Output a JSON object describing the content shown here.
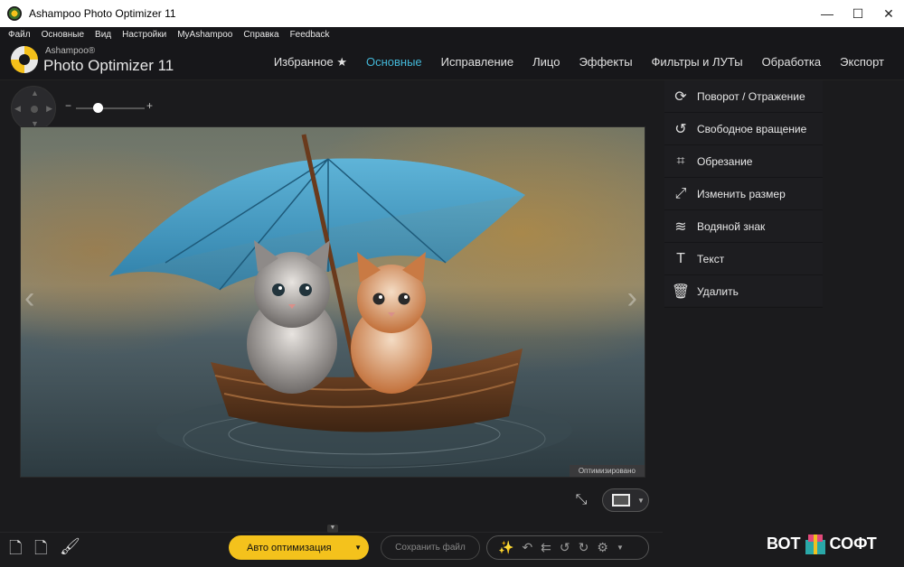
{
  "window": {
    "title": "Ashampoo Photo Optimizer 11",
    "minimize": "—",
    "maximize": "☐",
    "close": "✕"
  },
  "menu": [
    "Файл",
    "Основные",
    "Вид",
    "Настройки",
    "MyAshampoo",
    "Справка",
    "Feedback"
  ],
  "brand": {
    "small": "Ashampoo®",
    "big": "Photo Optimizer 11"
  },
  "tabs": [
    {
      "label": "Избранное ★",
      "active": false
    },
    {
      "label": "Основные",
      "active": true
    },
    {
      "label": "Исправление",
      "active": false
    },
    {
      "label": "Лицо",
      "active": false
    },
    {
      "label": "Эффекты",
      "active": false
    },
    {
      "label": "Фильтры и ЛУТы",
      "active": false
    },
    {
      "label": "Обработка",
      "active": false
    },
    {
      "label": "Экспорт",
      "active": false
    }
  ],
  "zoom": {
    "minus": "−",
    "plus": "+"
  },
  "photo": {
    "badge": "Оптимизировано"
  },
  "sidebar": {
    "items": [
      {
        "label": "Поворот / Отражение",
        "icon": "rotate-flip-icon",
        "glyph": "⟳"
      },
      {
        "label": "Свободное вращение",
        "icon": "free-rotate-icon",
        "glyph": "↺"
      },
      {
        "label": "Обрезание",
        "icon": "crop-icon",
        "glyph": "⌗"
      },
      {
        "label": "Изменить размер",
        "icon": "resize-icon",
        "glyph": "⤢"
      },
      {
        "label": "Водяной знак",
        "icon": "watermark-icon",
        "glyph": "≋"
      },
      {
        "label": "Текст",
        "icon": "text-icon",
        "glyph": "T"
      },
      {
        "label": "Удалить",
        "icon": "trash-icon",
        "glyph": "🗑"
      }
    ]
  },
  "bottom": {
    "auto_label": "Авто оптимизация",
    "save_label": "Сохранить файл"
  },
  "watermark": {
    "left": "ВОТ",
    "right": "СОФТ"
  },
  "colors": {
    "accent": "#43b6d6",
    "primary_button": "#f4c21c"
  }
}
